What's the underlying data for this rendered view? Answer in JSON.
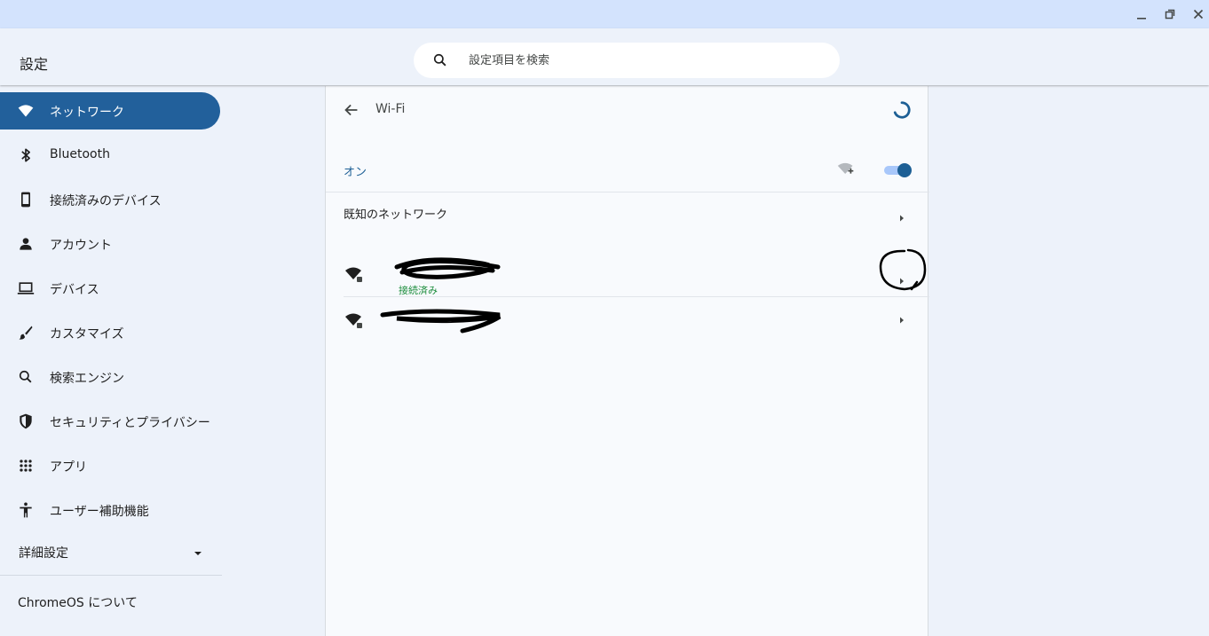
{
  "window": {
    "minimize_icon": "minimize-icon",
    "maximize_icon": "restore-icon",
    "close_icon": "close-icon"
  },
  "header": {
    "title": "設定",
    "search": {
      "placeholder": "設定項目を検索",
      "value": "",
      "icon": "search-icon"
    }
  },
  "sidebar": {
    "items": [
      {
        "label": "ネットワーク",
        "icon": "wifi-icon",
        "selected": true
      },
      {
        "label": "Bluetooth",
        "icon": "bluetooth-icon",
        "selected": false
      },
      {
        "label": "接続済みのデバイス",
        "icon": "phone-icon",
        "selected": false
      },
      {
        "label": "アカウント",
        "icon": "person-icon",
        "selected": false
      },
      {
        "label": "デバイス",
        "icon": "laptop-icon",
        "selected": false
      },
      {
        "label": "カスタマイズ",
        "icon": "brush-icon",
        "selected": false
      },
      {
        "label": "検索エンジン",
        "icon": "search-icon",
        "selected": false
      },
      {
        "label": "セキュリティとプライバシー",
        "icon": "shield-icon",
        "selected": false
      },
      {
        "label": "アプリ",
        "icon": "apps-grid-icon",
        "selected": false
      },
      {
        "label": "ユーザー補助機能",
        "icon": "accessibility-icon",
        "selected": false
      }
    ],
    "advanced": {
      "label": "詳細設定",
      "icon": "dropdown-arrow-icon"
    },
    "about": {
      "label": "ChromeOS について"
    }
  },
  "wifi_page": {
    "title": "Wi-Fi",
    "back_icon": "back-arrow-icon",
    "spinner_icon": "loading-spinner-icon",
    "toggle": {
      "label": "オン",
      "on": true,
      "add_network_icon": "add-wifi-icon"
    },
    "known_networks": {
      "label": "既知のネットワーク",
      "icon": "chevron-right-icon"
    },
    "networks": [
      {
        "status": "接続済み",
        "icon": "wifi-lock-icon",
        "name_redacted": true
      },
      {
        "status": "",
        "icon": "wifi-lock-icon",
        "name_redacted": true
      }
    ]
  },
  "colors": {
    "accent": "#1d5f95",
    "selected_nav": "#22609b",
    "connected_status": "#1e8e3e",
    "titlebar": "#d3e3fd",
    "background": "#edf2fa"
  }
}
